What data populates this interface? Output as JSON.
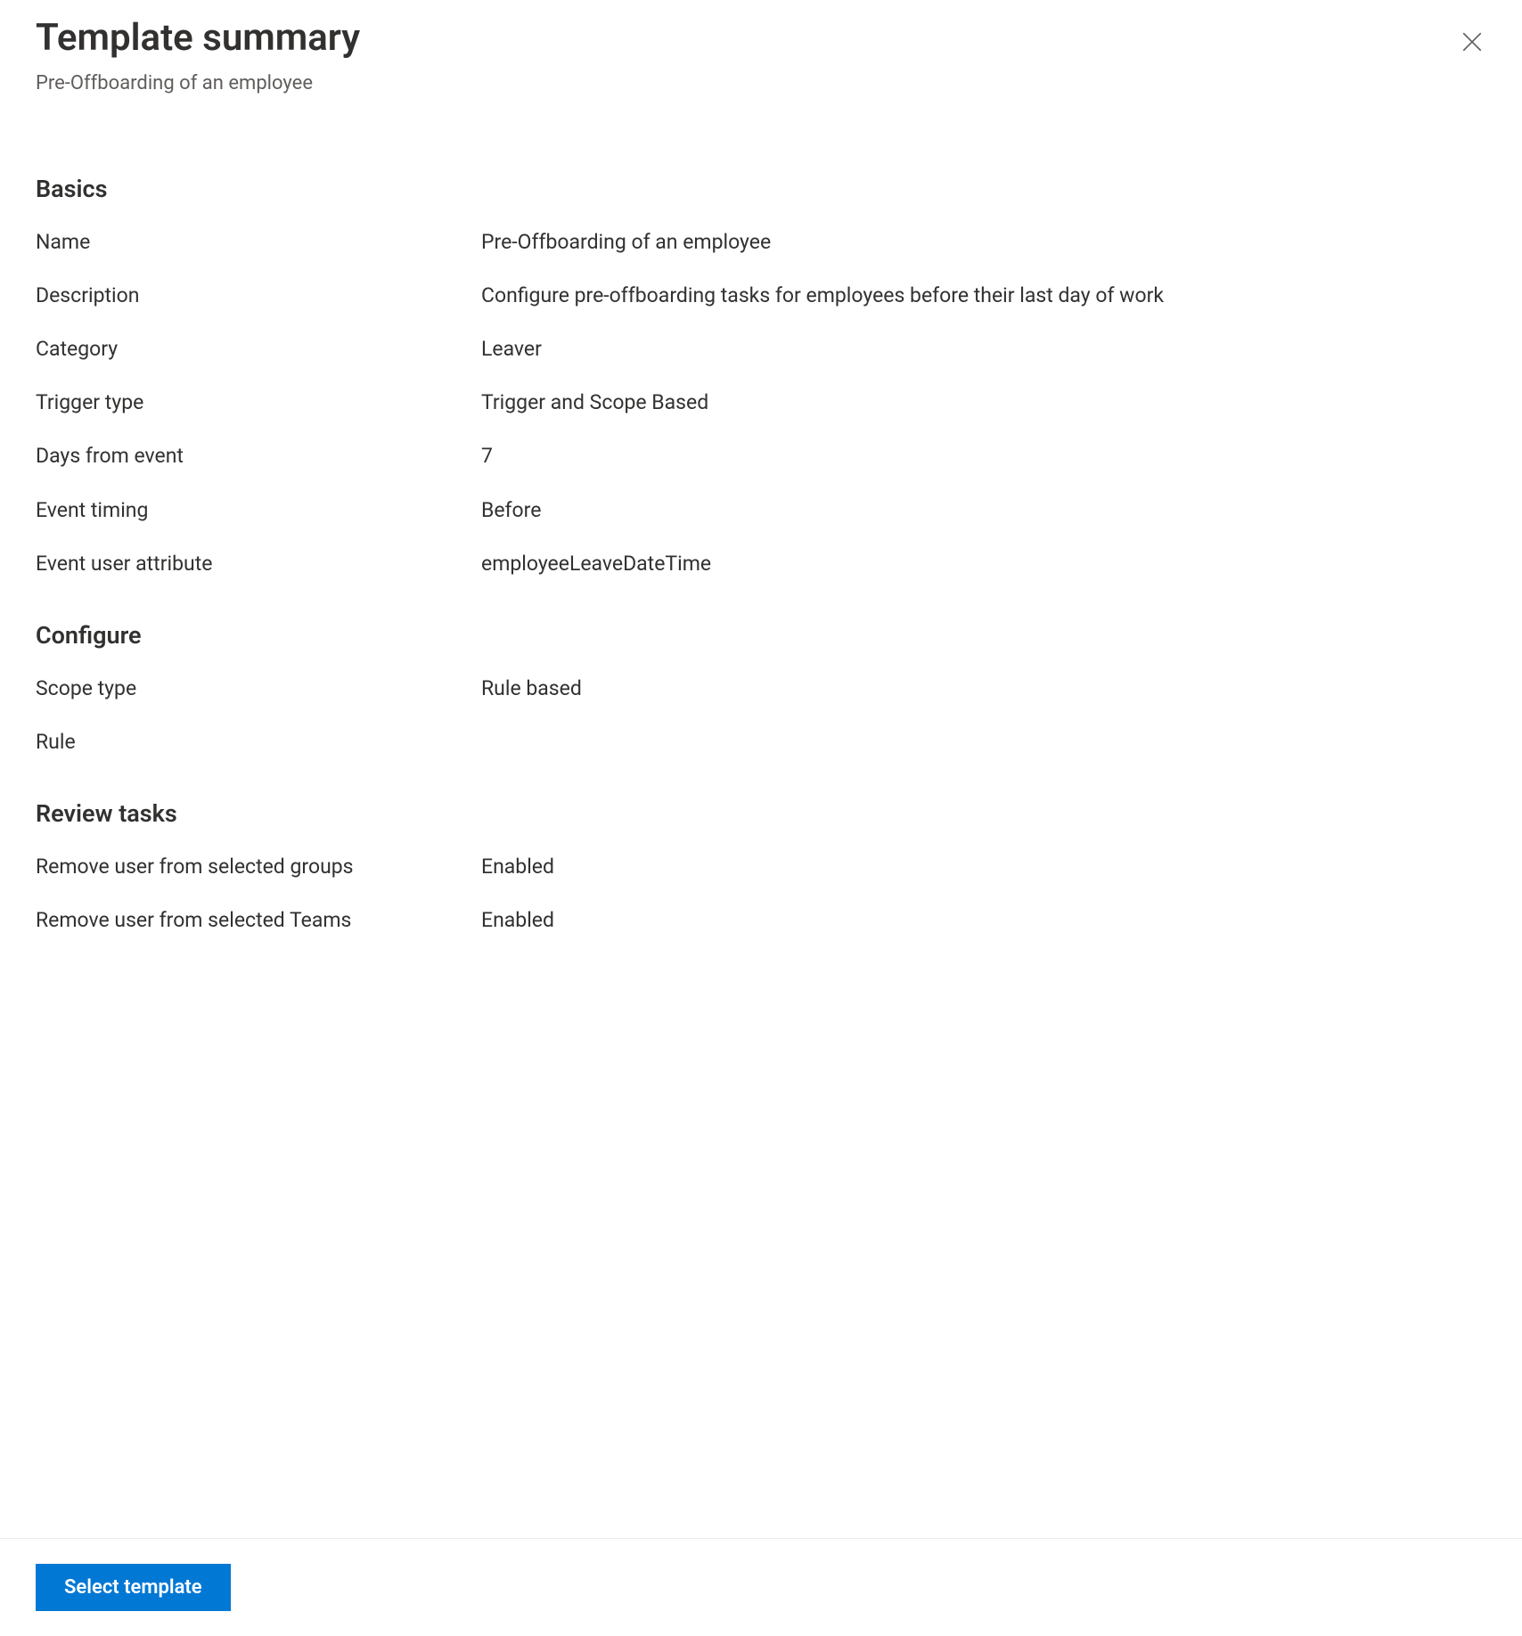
{
  "header": {
    "title": "Template summary",
    "subtitle": "Pre-Offboarding of an employee"
  },
  "sections": {
    "basics": {
      "title": "Basics",
      "fields": {
        "name": {
          "label": "Name",
          "value": "Pre-Offboarding of an employee"
        },
        "description": {
          "label": "Description",
          "value": "Configure pre-offboarding tasks for employees before their last day of work"
        },
        "category": {
          "label": "Category",
          "value": "Leaver"
        },
        "trigger_type": {
          "label": "Trigger type",
          "value": "Trigger and Scope Based"
        },
        "days_from_event": {
          "label": "Days from event",
          "value": "7"
        },
        "event_timing": {
          "label": "Event timing",
          "value": "Before"
        },
        "event_user_attribute": {
          "label": "Event user attribute",
          "value": "employeeLeaveDateTime"
        }
      }
    },
    "configure": {
      "title": "Configure",
      "fields": {
        "scope_type": {
          "label": "Scope type",
          "value": "Rule based"
        },
        "rule": {
          "label": "Rule",
          "value": ""
        }
      }
    },
    "review_tasks": {
      "title": "Review tasks",
      "fields": {
        "remove_groups": {
          "label": "Remove user from selected groups",
          "value": "Enabled"
        },
        "remove_teams": {
          "label": "Remove user from selected Teams",
          "value": "Enabled"
        }
      }
    }
  },
  "footer": {
    "select_template_label": "Select template"
  }
}
